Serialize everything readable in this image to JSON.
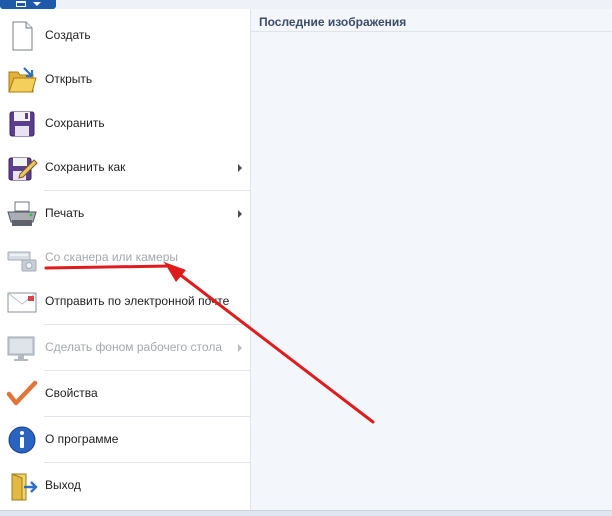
{
  "menu": {
    "items": [
      {
        "label": "Создать",
        "icon": "new-document-icon",
        "disabled": false,
        "submenu": false
      },
      {
        "label": "Открыть",
        "icon": "open-folder-icon",
        "disabled": false,
        "submenu": false
      },
      {
        "label": "Сохранить",
        "icon": "save-disk-icon",
        "disabled": false,
        "submenu": false
      },
      {
        "label": "Сохранить как",
        "icon": "save-as-icon",
        "disabled": false,
        "submenu": true
      },
      {
        "label": "Печать",
        "icon": "printer-icon",
        "disabled": false,
        "submenu": true
      },
      {
        "label": "Со сканера или камеры",
        "icon": "scanner-camera-icon",
        "disabled": true,
        "submenu": false
      },
      {
        "label": "Отправить по электронной почте",
        "icon": "email-envelope-icon",
        "disabled": false,
        "submenu": false
      },
      {
        "label": "Сделать фоном рабочего стола",
        "icon": "desktop-background-icon",
        "disabled": true,
        "submenu": true
      },
      {
        "label": "Свойства",
        "icon": "checkmark-properties-icon",
        "disabled": false,
        "submenu": false
      },
      {
        "label": "О программе",
        "icon": "info-icon",
        "disabled": false,
        "submenu": false
      },
      {
        "label": "Выход",
        "icon": "exit-door-icon",
        "disabled": false,
        "submenu": false
      }
    ]
  },
  "recent": {
    "title": "Последние изображения"
  },
  "colors": {
    "accent": "#1e5aa8",
    "annotation": "#e01b1b",
    "disabled_text": "#a4a8ae",
    "pane_bg": "#f3f6fb"
  }
}
